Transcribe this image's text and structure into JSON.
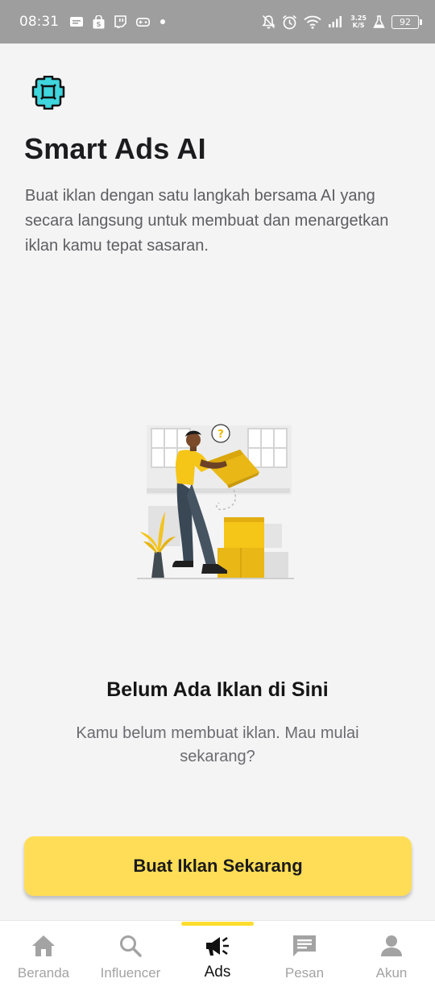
{
  "status_bar": {
    "time": "08:31",
    "speed_value": "3.25",
    "speed_unit": "K/S",
    "battery": "92",
    "left_icons": [
      "message-icon",
      "shopping-bag-icon",
      "twitch-icon",
      "gamepad-icon",
      "dot-icon"
    ],
    "right_icons": [
      "mute-icon",
      "alarm-icon",
      "wifi-icon",
      "signal-icon",
      "flask-icon",
      "battery-icon"
    ]
  },
  "header": {
    "logo_icon": "puzzle-piece-icon",
    "title": "Smart Ads AI",
    "description": "Buat iklan dengan satu langkah bersama AI yang secara langsung untuk membuat dan menargetkan iklan kamu tepat sasaran."
  },
  "empty_state": {
    "illustration": "person-carrying-box-illustration",
    "illustration_label": "?",
    "title": "Belum Ada Iklan di Sini",
    "description": "Kamu belum membuat iklan. Mau mulai sekarang?"
  },
  "cta": {
    "label": "Buat Iklan Sekarang"
  },
  "bottom_nav": {
    "items": [
      {
        "label": "Beranda",
        "icon": "home-icon",
        "active": false
      },
      {
        "label": "Influencer",
        "icon": "search-icon",
        "active": false
      },
      {
        "label": "Ads",
        "icon": "megaphone-icon",
        "active": true
      },
      {
        "label": "Pesan",
        "icon": "chat-icon",
        "active": false
      },
      {
        "label": "Akun",
        "icon": "person-icon",
        "active": false
      }
    ]
  },
  "colors": {
    "accent": "#ffdd57",
    "nav_indicator": "#ffdd2e",
    "logo": "#3fd6de",
    "status_bar": "#9e9e9e",
    "background": "#f4f4f5"
  }
}
